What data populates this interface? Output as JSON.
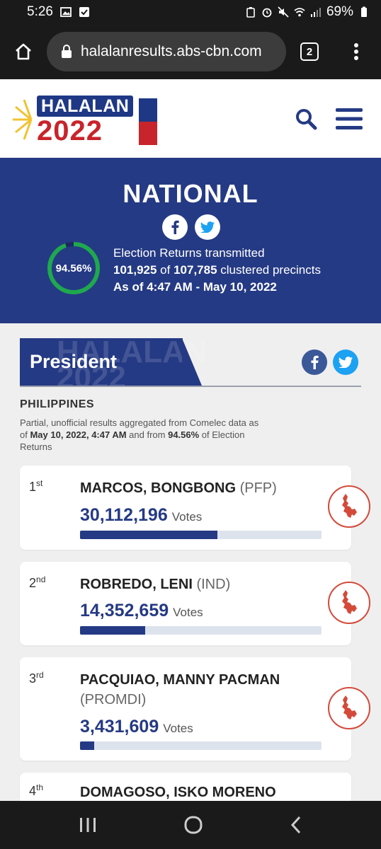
{
  "status_bar": {
    "time": "5:26",
    "battery": "69%"
  },
  "browser": {
    "url": "halalanresults.abs-cbn.com",
    "tab_count": "2"
  },
  "site": {
    "logo_top": "HALALAN",
    "logo_bottom": "2022"
  },
  "national": {
    "title": "NATIONAL",
    "percent": "94.56%",
    "percent_value": 94.56,
    "line1": "Election Returns transmitted",
    "transmitted": "101,925",
    "of_word": " of ",
    "total": "107,785",
    "clustered": " clustered precincts",
    "as_of": "As of 4:47 AM - May 10, 2022"
  },
  "president": {
    "title": "President",
    "ghost": "HALALAN 2022",
    "region": "PHILIPPINES",
    "partial_prefix": "Partial, unofficial results aggregated from Comelec data as of ",
    "partial_date": "May 10, 2022, 4:47 AM",
    "partial_mid": " and from ",
    "partial_pct": "94.56%",
    "partial_suffix": " of Election Returns"
  },
  "votes_word": "Votes",
  "candidates": [
    {
      "rank": "1",
      "rank_sup": "st",
      "name": "MARCOS, BONGBONG",
      "party": "(PFP)",
      "votes": "30,112,196",
      "bar_fraction": 0.57
    },
    {
      "rank": "2",
      "rank_sup": "nd",
      "name": "ROBREDO, LENI",
      "party": "(IND)",
      "votes": "14,352,659",
      "bar_fraction": 0.27
    },
    {
      "rank": "3",
      "rank_sup": "rd",
      "name": "PACQUIAO, MANNY PACMAN",
      "party": "(PROMDI)",
      "votes": "3,431,609",
      "bar_fraction": 0.06
    },
    {
      "rank": "4",
      "rank_sup": "th",
      "name": "DOMAGOSO, ISKO MORENO",
      "party": "",
      "votes": "",
      "bar_fraction": 0
    }
  ],
  "colors": {
    "navy": "#253a84",
    "red": "#c8242b",
    "facebook": "#3b5998",
    "twitter": "#1da1f2",
    "ring": "#1fa84f"
  }
}
